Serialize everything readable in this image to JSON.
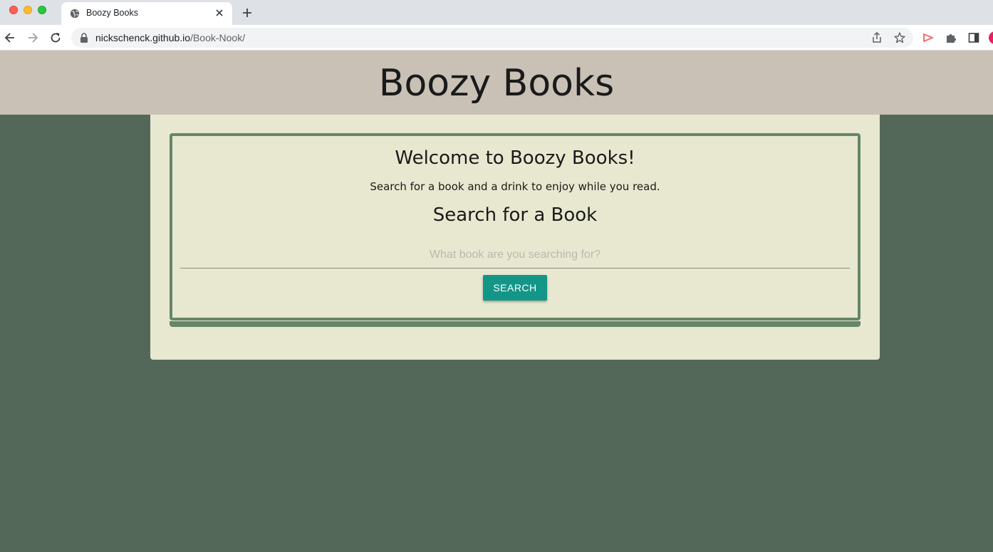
{
  "browser": {
    "tab_title": "Boozy Books",
    "url_host": "nickschenck.github.io",
    "url_path": "/Book-Nook/"
  },
  "header": {
    "title": "Boozy Books"
  },
  "main": {
    "welcome_heading": "Welcome to Boozy Books!",
    "subtitle": "Search for a book and a drink to enjoy while you read.",
    "search_heading": "Search for a Book",
    "search_placeholder": "What book are you searching for?",
    "search_button_label": "SEARCH"
  },
  "colors": {
    "page_background": "#536859",
    "header_background": "#c9c1b6",
    "card_background": "#e8e8d0",
    "card_border": "#658669",
    "button": "#139688"
  }
}
